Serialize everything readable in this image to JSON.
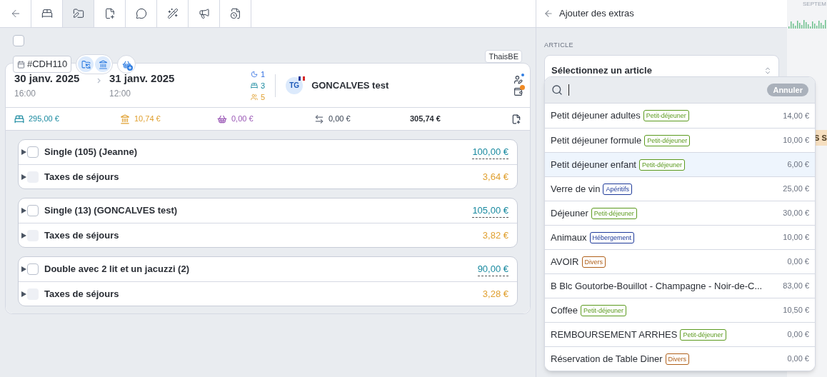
{
  "toolbar": {
    "tabs": [
      {
        "selected": false
      },
      {
        "selected": false
      },
      {
        "selected": true
      },
      {
        "selected": false
      },
      {
        "selected": false
      },
      {
        "selected": false
      },
      {
        "selected": false
      },
      {
        "selected": false
      }
    ]
  },
  "select_all": {
    "checked": false
  },
  "booking": {
    "reference": "#CDH110",
    "source": "ThaisBE",
    "arrival": {
      "date": "30 janv. 2025",
      "time": "16:00"
    },
    "departure": {
      "date": "31 janv. 2025",
      "time": "12:00"
    },
    "counts": {
      "nights": "1",
      "rooms": "3",
      "guests": "5"
    },
    "guest": {
      "initials": "TG",
      "name": "GONCALVES test"
    },
    "totals": {
      "accommodation": "295,00 €",
      "taxes": "10,74 €",
      "extras": "0,00 €",
      "transfers": "0,00 €",
      "total": "305,74 €"
    }
  },
  "groups": [
    {
      "lines": [
        {
          "kind": "room",
          "label": "Single (105) (Jeanne)",
          "amount": "100,00 €",
          "checked": false
        },
        {
          "kind": "tax",
          "label": "Taxes de séjours",
          "amount": "3,64 €",
          "checked": false
        }
      ]
    },
    {
      "lines": [
        {
          "kind": "room",
          "label": "Single (13) (GONCALVES test)",
          "amount": "105,00 €",
          "checked": false
        },
        {
          "kind": "tax",
          "label": "Taxes de séjours",
          "amount": "3,82 €",
          "checked": false
        }
      ]
    },
    {
      "lines": [
        {
          "kind": "room",
          "label": "Double avec 2 lit et un jacuzzi (2)",
          "amount": "90,00 €",
          "checked": false
        },
        {
          "kind": "tax",
          "label": "Taxes de séjours",
          "amount": "3,28 €",
          "checked": false
        }
      ]
    }
  ],
  "panel": {
    "title": "Ajouter des extras",
    "field_label": "ARTICLE",
    "select_placeholder": "Sélectionnez un article",
    "cancel": "Annuler",
    "items": [
      {
        "name": "Petit déjeuner adultes",
        "tag": {
          "label": "Petit-déjeuner",
          "color": "#5b9a1e"
        },
        "price": "14,00 €",
        "selected": false
      },
      {
        "name": "Petit déjeuner formule",
        "tag": {
          "label": "Petit-déjeuner",
          "color": "#5b9a1e"
        },
        "price": "10,00 €",
        "selected": false
      },
      {
        "name": "Petit déjeuner enfant",
        "tag": {
          "label": "Petit-déjeuner",
          "color": "#5b9a1e"
        },
        "price": "6,00 €",
        "selected": true
      },
      {
        "name": "Verre de vin",
        "tag": {
          "label": "Apéritifs",
          "color": "#1e3a9a"
        },
        "price": "25,00 €",
        "selected": false
      },
      {
        "name": "Déjeuner",
        "tag": {
          "label": "Petit-déjeuner",
          "color": "#5b9a1e"
        },
        "price": "30,00 €",
        "selected": false
      },
      {
        "name": "Animaux",
        "tag": {
          "label": "Hébergement",
          "color": "#1e3a9a"
        },
        "price": "10,00 €",
        "selected": false
      },
      {
        "name": "AVOIR",
        "tag": {
          "label": "Divers",
          "color": "#b0601a"
        },
        "price": "0,00 €",
        "selected": false
      },
      {
        "name": "B Blc Goutorbe-Bouillot - Champagne - Noir-de-C...",
        "price": "83,00 €",
        "selected": false
      },
      {
        "name": "Coffee",
        "tag": {
          "label": "Petit-déjeuner",
          "color": "#5b9a1e"
        },
        "price": "10,50 €",
        "selected": false
      },
      {
        "name": "REMBOURSEMENT ARRHES",
        "tag": {
          "label": "Petit-déjeuner",
          "color": "#5b9a1e"
        },
        "price": "0,00 €",
        "selected": false
      },
      {
        "name": "Réservation de Table Diner",
        "tag": {
          "label": "Divers",
          "color": "#b0601a"
        },
        "price": "0,00 €",
        "selected": false
      }
    ]
  },
  "background": {
    "month": "SEPTEM",
    "label": "S S"
  }
}
